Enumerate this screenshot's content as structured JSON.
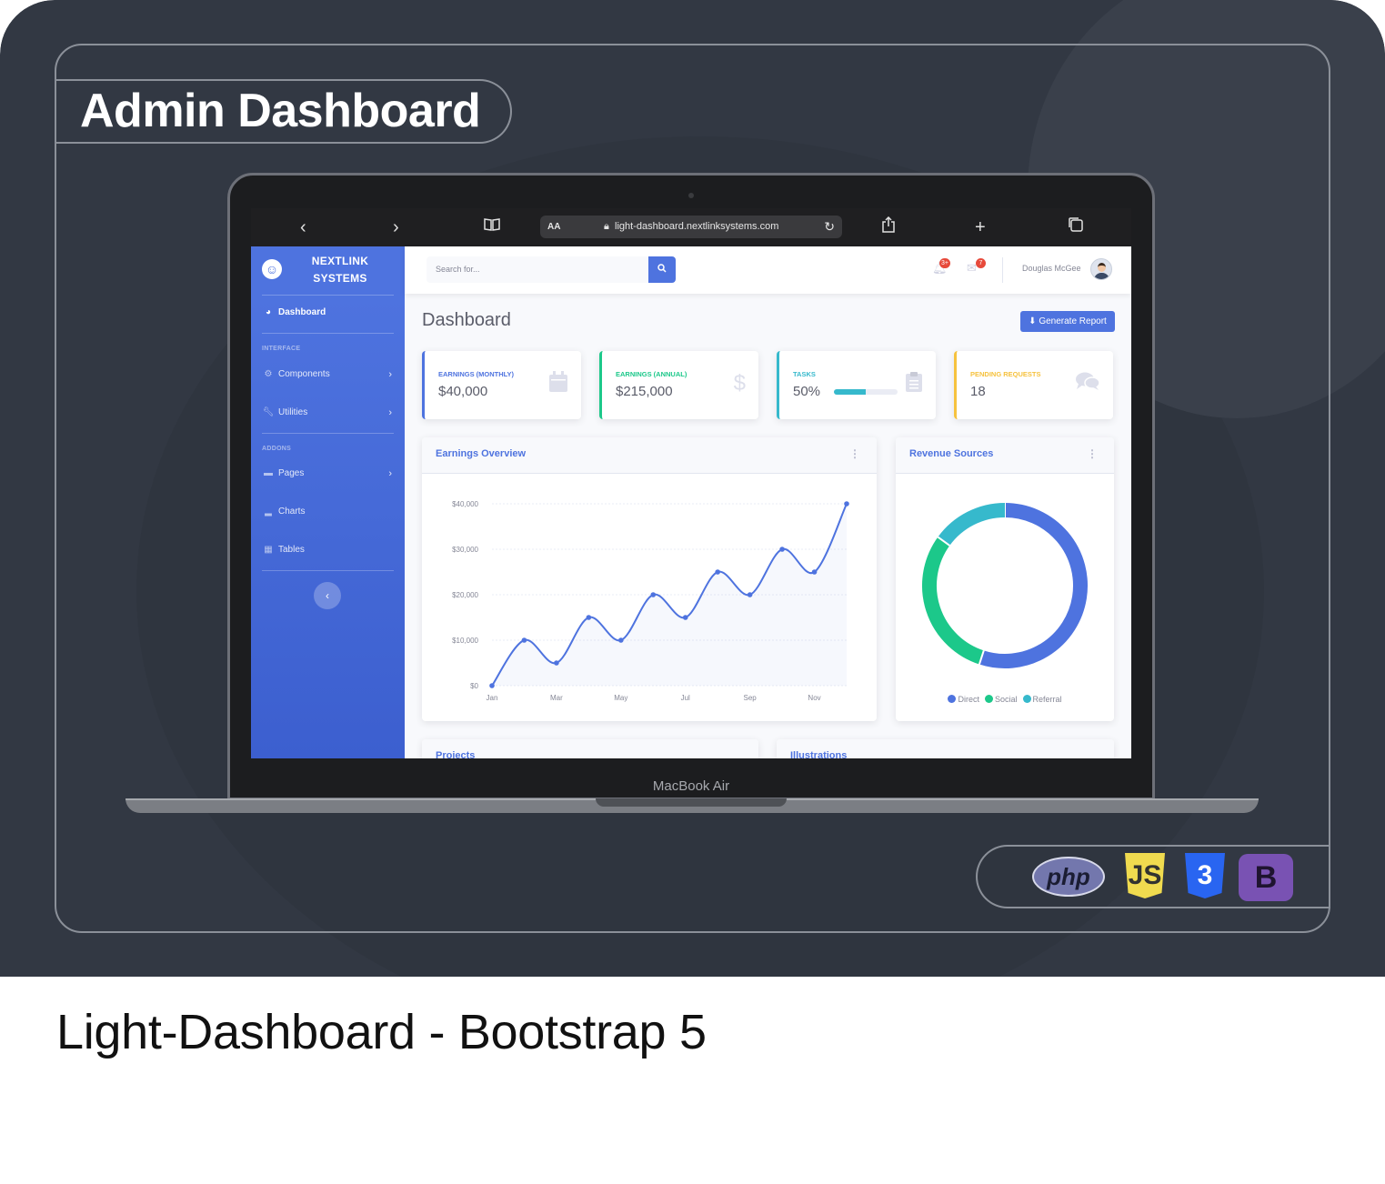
{
  "banner": {
    "title": "Admin Dashboard",
    "footer_title": "Light-Dashboard - Bootstrap 5",
    "device_label": "MacBook Air",
    "tech_badges": [
      {
        "name": "php-logo",
        "text": "php"
      },
      {
        "name": "js-logo",
        "text": "JS"
      },
      {
        "name": "css3-logo",
        "text": "3"
      },
      {
        "name": "bootstrap-logo",
        "text": "B"
      }
    ]
  },
  "browser": {
    "url": "light-dashboard.nextlinksystems.com",
    "reader_label": "AA",
    "icons": [
      "back-icon",
      "forward-icon",
      "bookmarks-icon",
      "lock-icon",
      "reload-icon",
      "share-icon",
      "new-tab-icon",
      "tabs-icon"
    ]
  },
  "sidebar": {
    "brand_line1": "NEXTLINK",
    "brand_line2": "SYSTEMS",
    "dashboard_label": "Dashboard",
    "heading_interface": "INTERFACE",
    "heading_addons": "ADDONS",
    "items": [
      {
        "label": "Components",
        "icon": "gear-icon",
        "chevron": "›"
      },
      {
        "label": "Utilities",
        "icon": "wrench-icon",
        "chevron": "›"
      },
      {
        "label": "Pages",
        "icon": "folder-icon",
        "chevron": "›"
      },
      {
        "label": "Charts",
        "icon": "chart-icon",
        "chevron": ""
      },
      {
        "label": "Tables",
        "icon": "table-icon",
        "chevron": ""
      }
    ]
  },
  "topbar": {
    "search_placeholder": "Search for...",
    "alerts_count": "3+",
    "messages_count": "7",
    "user_name": "Douglas McGee"
  },
  "page": {
    "title": "Dashboard",
    "generate_report": "Generate Report"
  },
  "stats": [
    {
      "label": "Earnings (Monthly)",
      "value": "$40,000",
      "color": "#4e73df",
      "icon": "calendar-icon"
    },
    {
      "label": "Earnings (Annual)",
      "value": "$215,000",
      "color": "#1cc88a",
      "icon": "dollar-icon"
    },
    {
      "label": "Tasks",
      "value": "50%",
      "color": "#36b9cc",
      "icon": "clipboard-icon",
      "progress": 0.5
    },
    {
      "label": "Pending Requests",
      "value": "18",
      "color": "#f6c23e",
      "icon": "comments-icon"
    }
  ],
  "earnings_panel": {
    "title": "Earnings Overview"
  },
  "revenue_panel": {
    "title": "Revenue Sources"
  },
  "bottom_panels": [
    "Projects",
    "Illustrations"
  ],
  "chart_data": [
    {
      "type": "area",
      "title": "Earnings Overview",
      "x": [
        "Jan",
        "Feb",
        "Mar",
        "Apr",
        "May",
        "Jun",
        "Jul",
        "Aug",
        "Sep",
        "Oct",
        "Nov",
        "Dec"
      ],
      "x_tick_labels": [
        "Jan",
        "Mar",
        "May",
        "Jul",
        "Sep",
        "Nov"
      ],
      "y_tick_labels": [
        "$0",
        "$10,000",
        "$20,000",
        "$30,000",
        "$40,000"
      ],
      "values": [
        0,
        10000,
        5000,
        15000,
        10000,
        20000,
        15000,
        25000,
        20000,
        30000,
        25000,
        40000
      ],
      "ylim": [
        0,
        40000
      ],
      "color": "#4e73df",
      "grid": true
    },
    {
      "type": "pie",
      "title": "Revenue Sources",
      "donut": true,
      "labels": [
        "Direct",
        "Social",
        "Referral"
      ],
      "values": [
        55,
        30,
        15
      ],
      "colors": [
        "#4e73df",
        "#1cc88a",
        "#36b9cc"
      ],
      "legend": "bottom"
    }
  ]
}
